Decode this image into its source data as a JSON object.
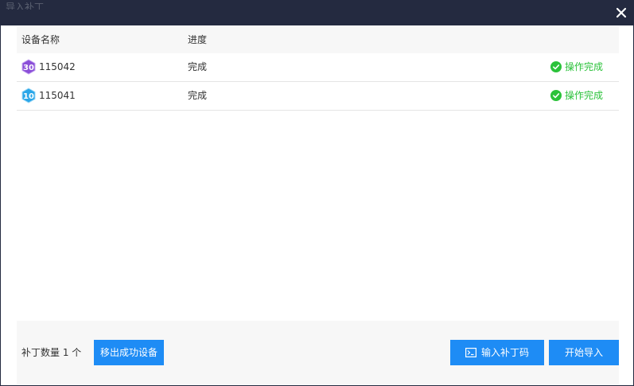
{
  "window": {
    "title": "导入补丁"
  },
  "table": {
    "headers": {
      "name": "设备名称",
      "progress": "进度"
    },
    "rows": [
      {
        "badge": "30",
        "badge_color": "#8b4fd8",
        "name": "115042",
        "progress": "完成",
        "status": "操作完成"
      },
      {
        "badge": "10",
        "badge_color": "#2aa6e8",
        "name": "115041",
        "progress": "完成",
        "status": "操作完成"
      }
    ]
  },
  "footer": {
    "patch_count": "补丁数量 1 个",
    "remove_button": "移出成功设备",
    "input_button": "输入补丁码",
    "start_button": "开始导入"
  },
  "colors": {
    "titlebar": "#242a40",
    "primary": "#1e8cf5",
    "success": "#2bc23a"
  }
}
